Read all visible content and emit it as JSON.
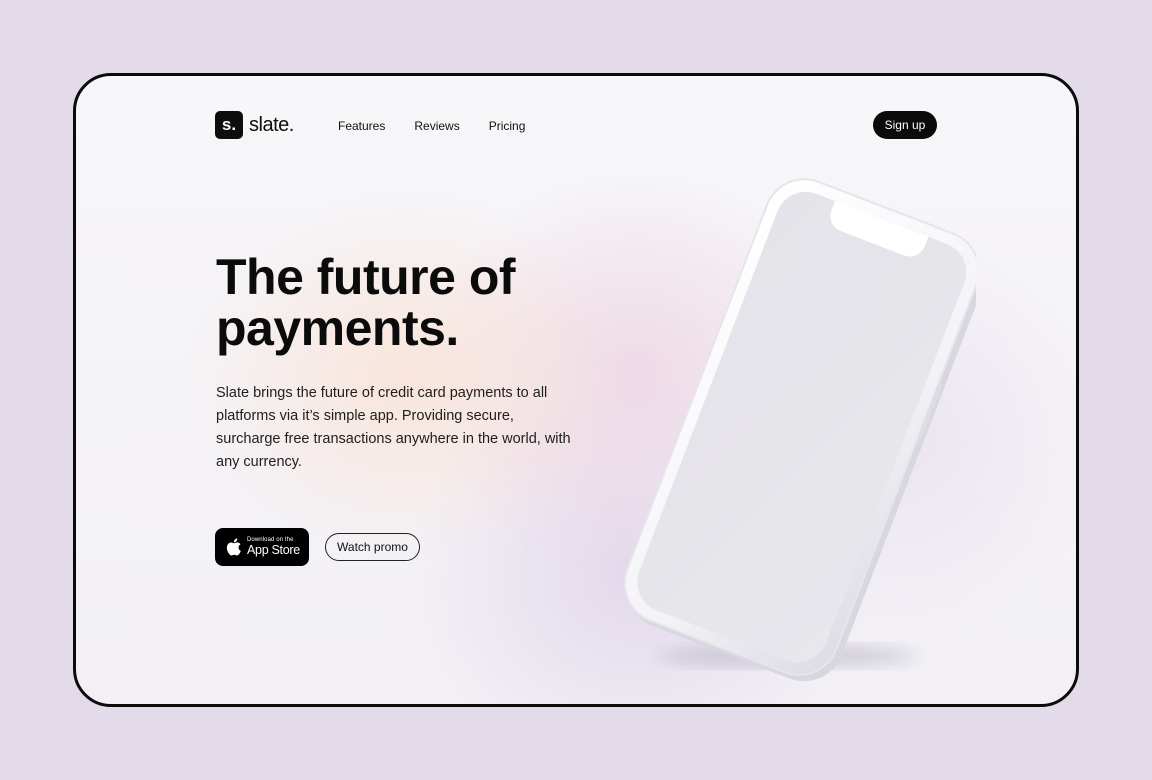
{
  "brand": {
    "mark": "s.",
    "name": "slate."
  },
  "nav": {
    "links": [
      "Features",
      "Reviews",
      "Pricing"
    ],
    "signup_label": "Sign up"
  },
  "hero": {
    "title_line1": "The future of",
    "title_line2": "payments.",
    "body": "Slate brings the future of credit card payments to all platforms via it’s simple app. Providing secure, surcharge free transactions anywhere in the world, with any currency."
  },
  "cta": {
    "appstore_small": "Download on the",
    "appstore_big": "App Store",
    "promo_label": "Watch promo"
  },
  "icons": {
    "logo": "logo-icon",
    "apple": "apple-icon",
    "phone": "phone-mockup"
  },
  "colors": {
    "background": "#e4dbea",
    "frame_border": "#0b0b0b",
    "primary": "#0b0b0b",
    "text": "#1e1e1e"
  }
}
